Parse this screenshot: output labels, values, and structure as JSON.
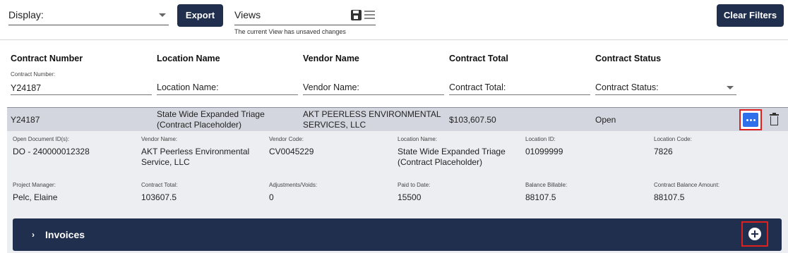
{
  "toolbar": {
    "display_label": "Display:",
    "export_label": "Export",
    "views_label": "Views",
    "views_note": "The current View has unsaved changes",
    "clear_filters_label": "Clear Filters"
  },
  "columns": {
    "contract_number": "Contract Number",
    "location_name": "Location Name",
    "vendor_name": "Vendor Name",
    "contract_total": "Contract Total",
    "contract_status": "Contract Status"
  },
  "filters": {
    "contract_number_label": "Contract Number:",
    "contract_number_value": "Y24187",
    "location_name_placeholder": "Location Name:",
    "vendor_name_placeholder": "Vendor Name:",
    "contract_total_placeholder": "Contract Total:",
    "contract_status_placeholder": "Contract Status:"
  },
  "row": {
    "contract_number": "Y24187",
    "location_name_line1": "State Wide Expanded Triage",
    "location_name_line2": "(Contract Placeholder)",
    "vendor_name_line1": "AKT PEERLESS ENVIRONMENTAL",
    "vendor_name_line2": "SERVICES, LLC",
    "contract_total": "$103,607.50",
    "contract_status": "Open"
  },
  "details": {
    "open_document_label": "Open Document ID(s):",
    "open_document_value": "DO - 240000012328",
    "vendor_name_label": "Vendor Name:",
    "vendor_name_line1": "AKT Peerless Environmental",
    "vendor_name_line2": "Service, LLC",
    "vendor_code_label": "Vendor Code:",
    "vendor_code_value": "CV0045229",
    "location_name_label": "Location Name:",
    "location_name_line1": "State Wide Expanded Triage",
    "location_name_line2": "(Contract Placeholder)",
    "location_id_label": "Location ID:",
    "location_id_value": "01099999",
    "location_code_label": "Location Code:",
    "location_code_value": "7826",
    "project_manager_label": "Project Manager:",
    "project_manager_value": "Pelc, Elaine",
    "contract_total_label": "Contract Total:",
    "contract_total_value": "103607.5",
    "adjustments_label": "Adjustments/Voids:",
    "adjustments_value": "0",
    "paid_to_date_label": "Paid to Date:",
    "paid_to_date_value": "15500",
    "balance_billable_label": "Balance Billable:",
    "balance_billable_value": "88107.5",
    "contract_balance_label": "Contract Balance Amount:",
    "contract_balance_value": "88107.5"
  },
  "invoices": {
    "title": "Invoices",
    "chevron": "›"
  },
  "icons": {
    "save": "save-icon",
    "list": "list-icon",
    "more": "more-actions-icon",
    "trash": "trash-icon",
    "add": "add-circle-icon"
  },
  "colors": {
    "primary_dark": "#1f2f4d",
    "highlight_red": "#e01f1f",
    "more_button_blue": "#2f6fea",
    "row_background": "#d3d6de",
    "detail_background": "#eceef2"
  }
}
